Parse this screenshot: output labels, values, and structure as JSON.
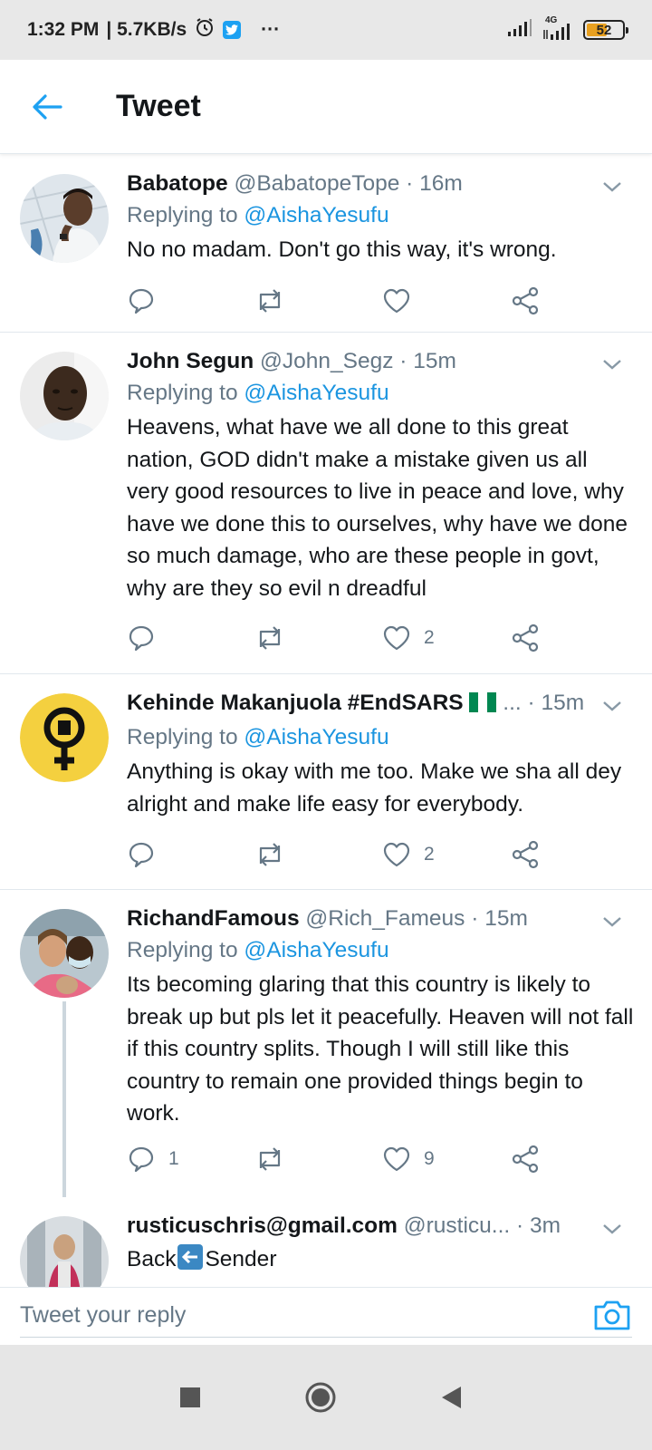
{
  "status_bar": {
    "time": "1:32 PM",
    "speed": "| 5.7KB/s",
    "more": "···",
    "network": "4G",
    "battery": "52"
  },
  "header": {
    "title": "Tweet"
  },
  "labels": {
    "replying_to": "Replying to",
    "mention": "@AishaYesufu"
  },
  "tweets": [
    {
      "name": "Babatope",
      "handle": "@BabatopeTope",
      "time": "· 16m",
      "text": "No no madam. Don't go this way, it's wrong.",
      "replies": "",
      "likes": ""
    },
    {
      "name": "John Segun",
      "handle": "@John_Segz",
      "time": "· 15m",
      "text": "Heavens, what have we all done to this great nation, GOD didn't make a mistake given us all very good resources to live in peace and love, why have we done this to ourselves, why have we done so much damage, who are these people in govt, why are they so evil n dreadful",
      "replies": "",
      "likes": "2"
    },
    {
      "name": "Kehinde Makanjuola #EndSARS",
      "handle": "...",
      "time": "· 15m",
      "text": "Anything is okay with me too. Make we sha all dey alright and make life easy for everybody.",
      "replies": "",
      "likes": "2"
    },
    {
      "name": "RichandFamous",
      "handle": "@Rich_Fameus",
      "time": "· 15m",
      "text": "Its becoming glaring that this country is likely to break up but pls let it peacefully. Heaven will not fall if this country splits. Though I will still like this country to remain one provided things begin to work.",
      "replies": "1",
      "likes": "9"
    },
    {
      "name": "rusticuschris@gmail.com",
      "handle": "@rusticu...",
      "time": "· 3m",
      "text_before": "Back",
      "text_after": "Sender"
    }
  ],
  "reply_bar": {
    "placeholder": "Tweet your reply"
  },
  "colors": {
    "accent": "#1da1f2",
    "mention": "#1b95e0",
    "secondary_text": "#657786",
    "divider": "#e1e8ed"
  }
}
